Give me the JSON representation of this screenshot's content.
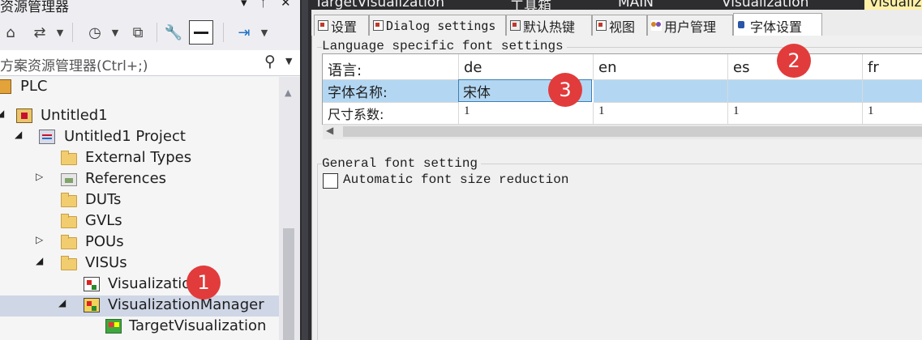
{
  "explorer": {
    "title": "资源管理器",
    "title_buttons": [
      "▾",
      "ᛘ",
      "✕"
    ],
    "toolbar_icons": [
      "home-icon",
      "sync-icon",
      "history-icon",
      "collapse-icon",
      "wrench-icon",
      "pin-icon",
      "preview-icon"
    ],
    "search_placeholder": "方案资源管理器(Ctrl+;)",
    "tree": [
      {
        "label": "PLC",
        "icon": "plc-icon",
        "arrow": ""
      },
      {
        "label": "Untitled1",
        "icon": "project-icon",
        "arrow": "◢"
      },
      {
        "label": "Untitled1 Project",
        "icon": "solution-project-icon",
        "arrow": "◢"
      },
      {
        "label": "External Types",
        "icon": "folder-icon",
        "arrow": ""
      },
      {
        "label": "References",
        "icon": "references-icon",
        "arrow": "▷"
      },
      {
        "label": "DUTs",
        "icon": "folder-icon",
        "arrow": ""
      },
      {
        "label": "GVLs",
        "icon": "folder-icon",
        "arrow": ""
      },
      {
        "label": "POUs",
        "icon": "folder-icon",
        "arrow": "▷"
      },
      {
        "label": "VISUs",
        "icon": "folder-open-icon",
        "arrow": "◢"
      },
      {
        "label": "Visualizatio",
        "icon": "visualization-icon",
        "arrow": ""
      },
      {
        "label": "VisualizationManager",
        "icon": "visualization-manager-icon",
        "arrow": "◢"
      },
      {
        "label": "TargetVisualization",
        "icon": "target-visualization-icon",
        "arrow": ""
      }
    ]
  },
  "doc_tabs": [
    "TargetVisualization",
    "工具箱",
    "MAIN",
    "Visualization",
    "Visualiz"
  ],
  "sub_tabs": [
    "设置",
    "Dialog settings",
    "默认热键",
    "视图",
    "用户管理",
    "字体设置"
  ],
  "language_group": {
    "title": "Language specific font settings",
    "header": [
      "语言:",
      "de",
      "en",
      "es",
      "fr"
    ],
    "font_name_label": "字体名称:",
    "font_name_values": [
      "宋体",
      "",
      "",
      ""
    ],
    "size_label": "尺寸系数:",
    "size_values": [
      "1",
      "1",
      "1",
      "1"
    ]
  },
  "general_group": {
    "title": "General font setting",
    "checkbox_label": "Automatic font size reduction",
    "checkbox_checked": false
  },
  "annotations": [
    "1",
    "2",
    "3"
  ]
}
